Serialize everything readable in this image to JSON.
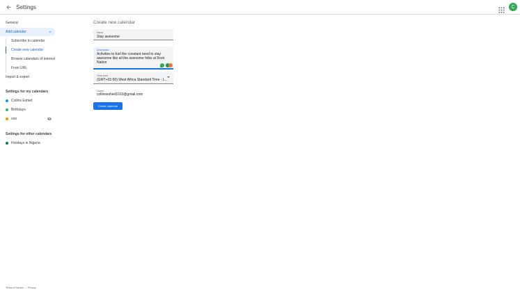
{
  "header": {
    "title": "Settings",
    "avatar_letter": "C",
    "colors": {
      "avatar": "#33a852"
    }
  },
  "sidebar": {
    "general": "General",
    "add_calendar": "Add calendar",
    "add_calendar_items": [
      {
        "label": "Subscribe to calendar",
        "active": false
      },
      {
        "label": "Create new calendar",
        "active": true
      },
      {
        "label": "Browse calendars of interest",
        "active": false
      },
      {
        "label": "From URL",
        "active": false
      }
    ],
    "import_export": "Import & export",
    "my_calendars_heading": "Settings for my calendars",
    "my_calendars": [
      {
        "label": "Collins Eshiet",
        "color": "#039be5"
      },
      {
        "label": "Birthdays",
        "color": "#33b679"
      },
      {
        "label": "ooo",
        "color": "#f09300"
      }
    ],
    "other_calendars_heading": "Settings for other calendars",
    "other_calendars": [
      {
        "label": "Holidays in Nigeria",
        "color": "#0b8043"
      }
    ]
  },
  "form": {
    "title": "Create new calendar",
    "name": {
      "label": "Name",
      "value": "Stay awesome"
    },
    "description": {
      "label": "Description",
      "line1": "Activities to fuel the constant need to stay",
      "line2": "awesome like all the awesome folks at Root",
      "line3": "Nation"
    },
    "timezone": {
      "label": "Time zone",
      "value": "(GMT+01:00) West Africa Standard Time - L..."
    },
    "owner": {
      "label": "Owner",
      "value": "collinseshiet1010@gmail.com"
    },
    "create_button": "Create calendar"
  },
  "footer": {
    "terms": "Terms of Service",
    "separator": "–",
    "privacy": "Privacy"
  }
}
